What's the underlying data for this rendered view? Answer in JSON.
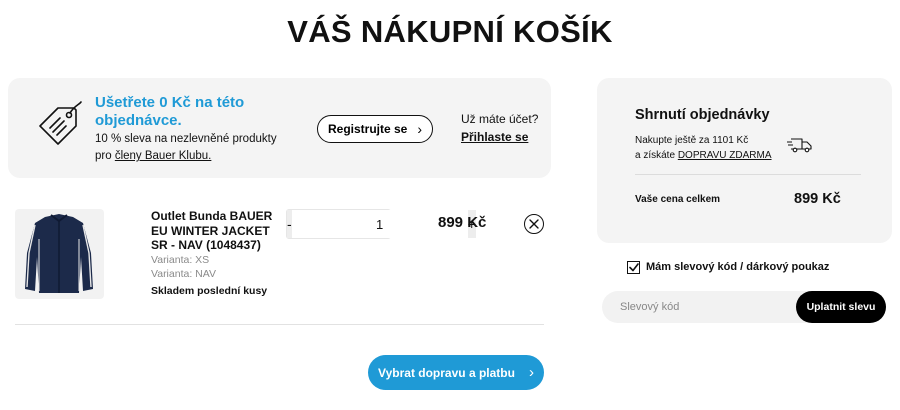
{
  "page": {
    "title": "VÁŠ NÁKUPNÍ KOŠÍK"
  },
  "colors": {
    "accent": "#1f9ad6",
    "panel": "#f4f4f4",
    "dark": "#000000"
  },
  "promo": {
    "icon": "price-tag-icon",
    "headline": "Ušetřete 0 Kč na této objednávce.",
    "text_prefix": "10 % sleva na nezlevněné produkty pro ",
    "text_link": "členy Bauer Klubu.",
    "register_label": "Registrujte se",
    "account_question": "Už máte účet?",
    "login_label": "Přihlaste se"
  },
  "cart": {
    "items": [
      {
        "name": "Outlet Bunda BAUER EU WINTER JACKET SR - NAV (1048437)",
        "variant_size": "Varianta: XS",
        "variant_color": "Varianta: NAV",
        "stock": "Skladem poslední kusy",
        "quantity": "1",
        "minus_label": "-",
        "plus_label": "+",
        "price": "899 Kč",
        "image_icon": "jacket-image"
      }
    ],
    "checkout_label": "Vybrat dopravu a platbu"
  },
  "summary": {
    "title": "Shrnutí objednávky",
    "shipping_line1": "Nakupte ještě za 1101 Kč",
    "shipping_line2_prefix": "a získáte ",
    "shipping_link": "DOPRAVU ZDARMA",
    "truck_icon": "truck-icon",
    "total_label": "Vaše cena celkem",
    "total_value": "899 Kč"
  },
  "discount": {
    "checked": true,
    "label": "Mám slevový kód / dárkový poukaz",
    "placeholder": "Slevový kód",
    "apply_label": "Uplatnit slevu"
  }
}
